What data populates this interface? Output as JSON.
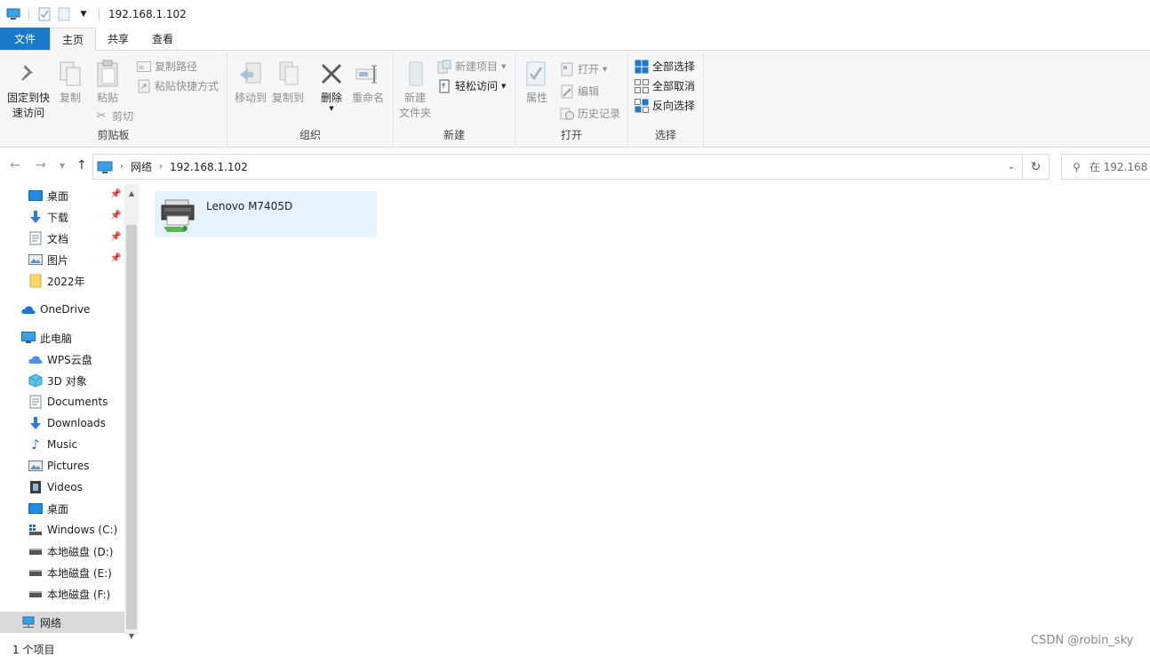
{
  "window": {
    "title": "192.168.1.102"
  },
  "tabs": [
    {
      "label": "文件"
    },
    {
      "label": "主页"
    },
    {
      "label": "共享"
    },
    {
      "label": "查看"
    }
  ],
  "ribbon": {
    "clipboard": {
      "label": "剪贴板",
      "pin_label_1": "固定到快",
      "pin_label_2": "速访问",
      "copy": "复制",
      "paste": "粘贴",
      "copy_path": "复制路径",
      "paste_shortcut": "粘贴快捷方式",
      "cut": "剪切"
    },
    "organize": {
      "label": "组织",
      "move_to": "移动到",
      "copy_to": "复制到",
      "delete": "删除",
      "rename": "重命名"
    },
    "new": {
      "label": "新建",
      "new_folder_1": "新建",
      "new_folder_2": "文件夹",
      "new_item": "新建项目",
      "easy_access": "轻松访问"
    },
    "open": {
      "label": "打开",
      "properties": "属性",
      "open": "打开",
      "edit": "编辑",
      "history": "历史记录"
    },
    "select": {
      "label": "选择",
      "select_all": "全部选择",
      "select_none": "全部取消",
      "invert": "反向选择"
    }
  },
  "address": {
    "crumbs": [
      "网络",
      "192.168.1.102"
    ],
    "search_placeholder": "在 192.168"
  },
  "nav": {
    "quick": [
      {
        "label": "桌面",
        "pinned": true
      },
      {
        "label": "下载",
        "pinned": true
      },
      {
        "label": "文档",
        "pinned": true
      },
      {
        "label": "图片",
        "pinned": true
      },
      {
        "label": "2022年",
        "pinned": false
      }
    ],
    "onedrive": "OneDrive",
    "this_pc": "此电脑",
    "pc_items": [
      {
        "label": "WPS云盘"
      },
      {
        "label": "3D 对象"
      },
      {
        "label": "Documents"
      },
      {
        "label": "Downloads"
      },
      {
        "label": "Music"
      },
      {
        "label": "Pictures"
      },
      {
        "label": "Videos"
      },
      {
        "label": "桌面"
      },
      {
        "label": "Windows (C:)"
      },
      {
        "label": "本地磁盘 (D:)"
      },
      {
        "label": "本地磁盘 (E:)"
      },
      {
        "label": "本地磁盘 (F:)"
      }
    ],
    "network": "网络"
  },
  "content": {
    "items": [
      {
        "name": "Lenovo M7405D"
      }
    ]
  },
  "status": {
    "count": "1 个项目"
  },
  "watermark": "CSDN @robin_sky"
}
